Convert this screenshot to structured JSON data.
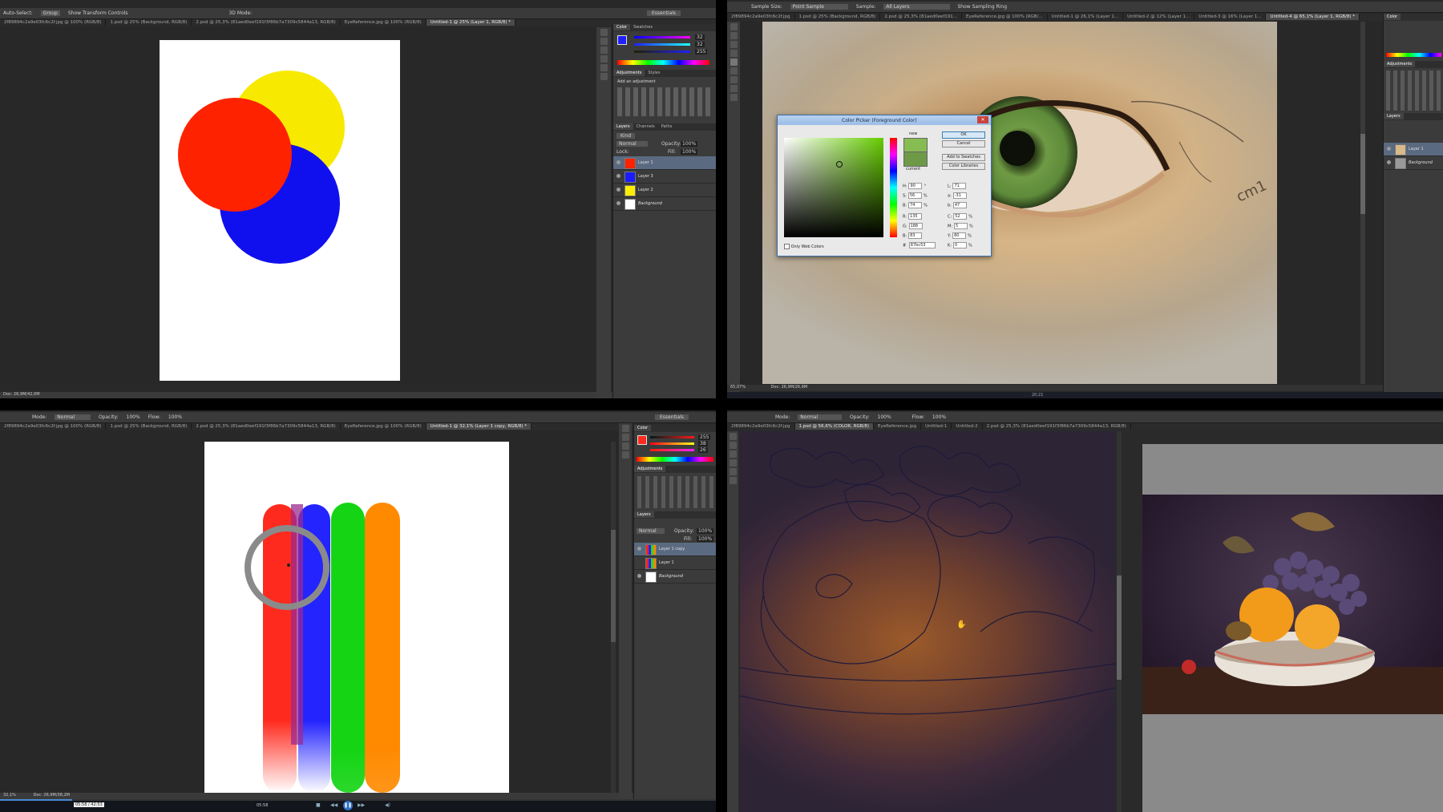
{
  "q1": {
    "options": [
      "Auto-Select:",
      "Group",
      "Show Transform Controls",
      "3D Mode:",
      "Essentials"
    ],
    "tabs": [
      {
        "label": "2f89894c2a9e03fc6c2f.jpg @ 100% (RGB/8)",
        "active": false
      },
      {
        "label": "1.psd @ 25% (Background, RGB/8)",
        "active": false
      },
      {
        "label": "2.psd @ 25,3% (81aed0eef191f3f86b7a7309c5844a13, RGB/8)",
        "active": false
      },
      {
        "label": "EyeReference.jpg @ 100% (RGB/8)",
        "active": false
      },
      {
        "label": "Untitled-1 @ 25% (Layer 1, RGB/8) *",
        "active": true
      }
    ],
    "panel_tabs": {
      "color": "Color",
      "swatches": "Swatches",
      "adjustments": "Adjustments",
      "styles": "Styles",
      "add_adjustment": "Add an adjustment",
      "layers": "Layers",
      "channels": "Channels",
      "paths": "Paths",
      "kind": "Kind",
      "blend": "Normal",
      "opacity_label": "Opacity:",
      "opacity": "100%",
      "lock": "Lock:",
      "fill_label": "Fill:",
      "fill": "100%"
    },
    "color_values": {
      "r": "32",
      "g": "32",
      "b": "255"
    },
    "layers": [
      {
        "name": "Layer 1",
        "selected": true,
        "thumb": "#ff2200"
      },
      {
        "name": "Layer 3",
        "selected": false,
        "thumb": "#1a1aff"
      },
      {
        "name": "Layer 2",
        "selected": false,
        "thumb": "#ffee00"
      },
      {
        "name": "Background",
        "selected": false,
        "thumb": "#ffffff"
      }
    ],
    "status": "Doc: 26,9M/42,0M",
    "colors": {
      "red": "#ff2200",
      "yellow": "#f7ea00",
      "blue": "#1010ee"
    }
  },
  "q2": {
    "options": [
      "Sample Size:",
      "Point Sample",
      "Sample:",
      "All Layers",
      "Show Sampling Ring"
    ],
    "tabs": [
      {
        "label": "2f89894c2a9e03fc6c2f.jpg",
        "active": false
      },
      {
        "label": "1.psd @ 25% (Background, RGB/8)",
        "active": false
      },
      {
        "label": "2.psd @ 25,3% (81aed0eef191...",
        "active": false
      },
      {
        "label": "EyeReference.jpg @ 100% (RGB/...",
        "active": false
      },
      {
        "label": "Untitled-1 @ 26,1% (Layer 1...",
        "active": false
      },
      {
        "label": "Untitled-2 @ 12% (Layer 1...",
        "active": false
      },
      {
        "label": "Untitled-3 @ 16% (Layer 1...",
        "active": false
      },
      {
        "label": "Untitled-4 @ 65,1% (Layer 1, RGB/8) *",
        "active": true
      }
    ],
    "dialog": {
      "title": "Color Picker (Foreground Color)",
      "ok": "OK",
      "cancel": "Cancel",
      "add_swatches": "Add to Swatches",
      "libraries": "Color Libraries",
      "new_label": "new",
      "current_label": "current",
      "web_only": "Only Web Colors",
      "h": "90",
      "s": "56",
      "b": "74",
      "r": "135",
      "g": "188",
      "b2": "83",
      "l": "71",
      "a": "-31",
      "b3": "47",
      "c": "52",
      "m": "5",
      "y": "80",
      "k": "0",
      "hex": "87bc53",
      "new_color": "#87bc53",
      "current_color": "#6e9a48"
    },
    "status_left": "65,07%",
    "status": "Doc: 26,9M/26,9M",
    "time": "20:21",
    "canvas_text": "cm1",
    "layers": [
      {
        "name": "Layer 1",
        "selected": true
      },
      {
        "name": "Background",
        "selected": false
      }
    ]
  },
  "q3": {
    "options": [
      "Mode:",
      "Normal",
      "Opacity:",
      "100%",
      "Flow:",
      "100%",
      "Essentials"
    ],
    "tabs": [
      {
        "label": "2f89894c2a9e03fc6c2f.jpg @ 100% (RGB/8)",
        "active": false
      },
      {
        "label": "1.psd @ 25% (Background, RGB/8)",
        "active": false
      },
      {
        "label": "2.psd @ 25,3% (81aed0eef191f3f86b7a7309c5844a13, RGB/8)",
        "active": false
      },
      {
        "label": "EyeReference.jpg @ 100% (RGB/8)",
        "active": false
      },
      {
        "label": "Untitled-1 @ 32,1% (Layer 1 copy, RGB/8) *",
        "active": true
      }
    ],
    "color_values": {
      "r": "255",
      "g": "38",
      "b": "26"
    },
    "layers": [
      {
        "name": "Layer 1 copy",
        "selected": true
      },
      {
        "name": "Layer 1",
        "selected": false
      },
      {
        "name": "Background",
        "selected": false
      }
    ],
    "status": "Doc: 26,9M/38,2M",
    "zoom": "32,1%",
    "player": {
      "elapsed": "05:58",
      "total": "05:58 / 42:53"
    },
    "strokes": [
      {
        "color": "#ff2a1e"
      },
      {
        "color": "#2424ff"
      },
      {
        "color": "#14d414"
      },
      {
        "color": "#ff8a00"
      }
    ],
    "panel_tabs": {
      "blend": "Normal",
      "opacity_label": "Opacity:",
      "opacity": "100%",
      "fill_label": "Fill:",
      "fill": "100%"
    }
  },
  "q4": {
    "options": [
      "Mode:",
      "Normal",
      "Opacity:",
      "100%",
      "Flow:",
      "100%"
    ],
    "tabs": [
      {
        "label": "2f89894c2a9e03fc6c2f.jpg",
        "active": false
      },
      {
        "label": "1.psd @ 56,6% (COLOR, RGB/8)",
        "active": true
      },
      {
        "label": "EyeReference.jpg",
        "active": false
      },
      {
        "label": "Untitled-1",
        "active": false
      },
      {
        "label": "Untitled-2",
        "active": false
      },
      {
        "label": "2.psd @ 25,3% (81aed0eef191f3f86b7a7309c5844a13, RGB/8)",
        "active": false
      }
    ]
  }
}
